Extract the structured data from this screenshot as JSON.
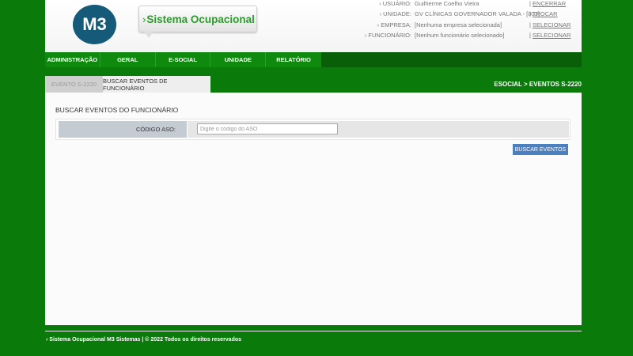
{
  "logo": {
    "text": "M3"
  },
  "brand": {
    "arrow": "›",
    "title": "Sistema Ocupacional"
  },
  "user_info": [
    {
      "label": "USUÁRIO:",
      "value": "Guilherme Coelho Vieira",
      "action": "ENCERRAR"
    },
    {
      "label": "UNIDADE:",
      "value": "GV CLÍNICAS GOVERNADOR VALADA - [003]",
      "action": "TROCAR"
    },
    {
      "label": "EMPRESA:",
      "value": "[Nenhuma empresa selecionada]",
      "action": "SELECIONAR"
    },
    {
      "label": "FUNCIONÁRIO:",
      "value": "[Nenhum funcionário selecionado]",
      "action": "SELECIONAR"
    }
  ],
  "nav": [
    "ADMINISTRAÇÃO",
    "GERAL",
    "E-SOCIAL",
    "UNIDADE",
    "RELATÓRIO"
  ],
  "tabs": [
    {
      "label": "EVENTO S-2220"
    },
    {
      "label": "BUSCAR EVENTOS DE FUNCIONÁRIO"
    }
  ],
  "breadcrumb": "ESOCIAL > EVENTOS S-2220",
  "form": {
    "section_title": "BUSCAR EVENTOS DO FUNCIONÁRIO",
    "aso_label": "CÓDIGO ASO:",
    "aso_value": "",
    "aso_placeholder": "Digite o código do ASO",
    "search_button": "BUSCAR EVENTOS"
  },
  "footer": "› Sistema Ocupacional M3 Sistemas | © 2022 Todos os direitos reservados",
  "colors": {
    "background_green": "#0a7a0a",
    "nav_green": "#0f8a0f",
    "brand_green": "#2d9a2d",
    "logo_blue": "#165a7a",
    "button_blue": "#4a7fc0"
  }
}
